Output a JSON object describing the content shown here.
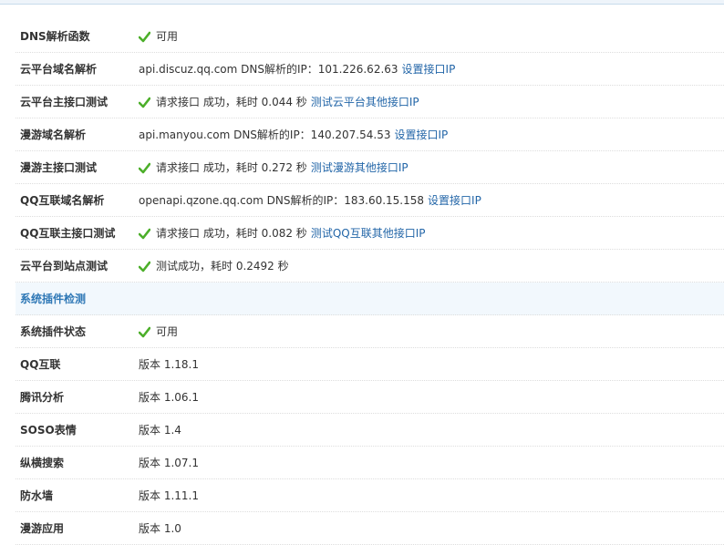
{
  "rows_top": [
    {
      "label": "DNS解析函数",
      "ok": true,
      "text": "可用"
    },
    {
      "label": "云平台域名解析",
      "ok": false,
      "text": "api.discuz.qq.com DNS解析的IP：101.226.62.63",
      "link": "设置接口IP"
    },
    {
      "label": "云平台主接口测试",
      "ok": true,
      "text": "请求接口 成功，耗时 0.044 秒",
      "link": "测试云平台其他接口IP"
    },
    {
      "label": "漫游域名解析",
      "ok": false,
      "text": "api.manyou.com DNS解析的IP：140.207.54.53",
      "link": "设置接口IP"
    },
    {
      "label": "漫游主接口测试",
      "ok": true,
      "text": "请求接口 成功，耗时 0.272 秒",
      "link": "测试漫游其他接口IP"
    },
    {
      "label": "QQ互联域名解析",
      "ok": false,
      "text": "openapi.qzone.qq.com DNS解析的IP：183.60.15.158",
      "link": "设置接口IP"
    },
    {
      "label": "QQ互联主接口测试",
      "ok": true,
      "text": "请求接口 成功，耗时 0.082 秒",
      "link": "测试QQ互联其他接口IP"
    },
    {
      "label": "云平台到站点测试",
      "ok": true,
      "text": "测试成功，耗时 0.2492 秒"
    }
  ],
  "section_title": "系统插件检测",
  "rows_bottom": [
    {
      "label": "系统插件状态",
      "ok": true,
      "text": "可用"
    },
    {
      "label": "QQ互联",
      "ok": false,
      "text": "版本 1.18.1"
    },
    {
      "label": "腾讯分析",
      "ok": false,
      "text": "版本 1.06.1"
    },
    {
      "label": "SOSO表情",
      "ok": false,
      "text": "版本 1.4"
    },
    {
      "label": "纵横搜索",
      "ok": false,
      "text": "版本 1.07.1"
    },
    {
      "label": "防水墙",
      "ok": false,
      "text": "版本 1.11.1"
    },
    {
      "label": "漫游应用",
      "ok": false,
      "text": "版本 1.0"
    }
  ],
  "colors": {
    "accent": "#2f78b6",
    "link": "#2366a8",
    "ok": "#4caf2a"
  },
  "icons": {
    "ok": "checkmark-icon"
  }
}
